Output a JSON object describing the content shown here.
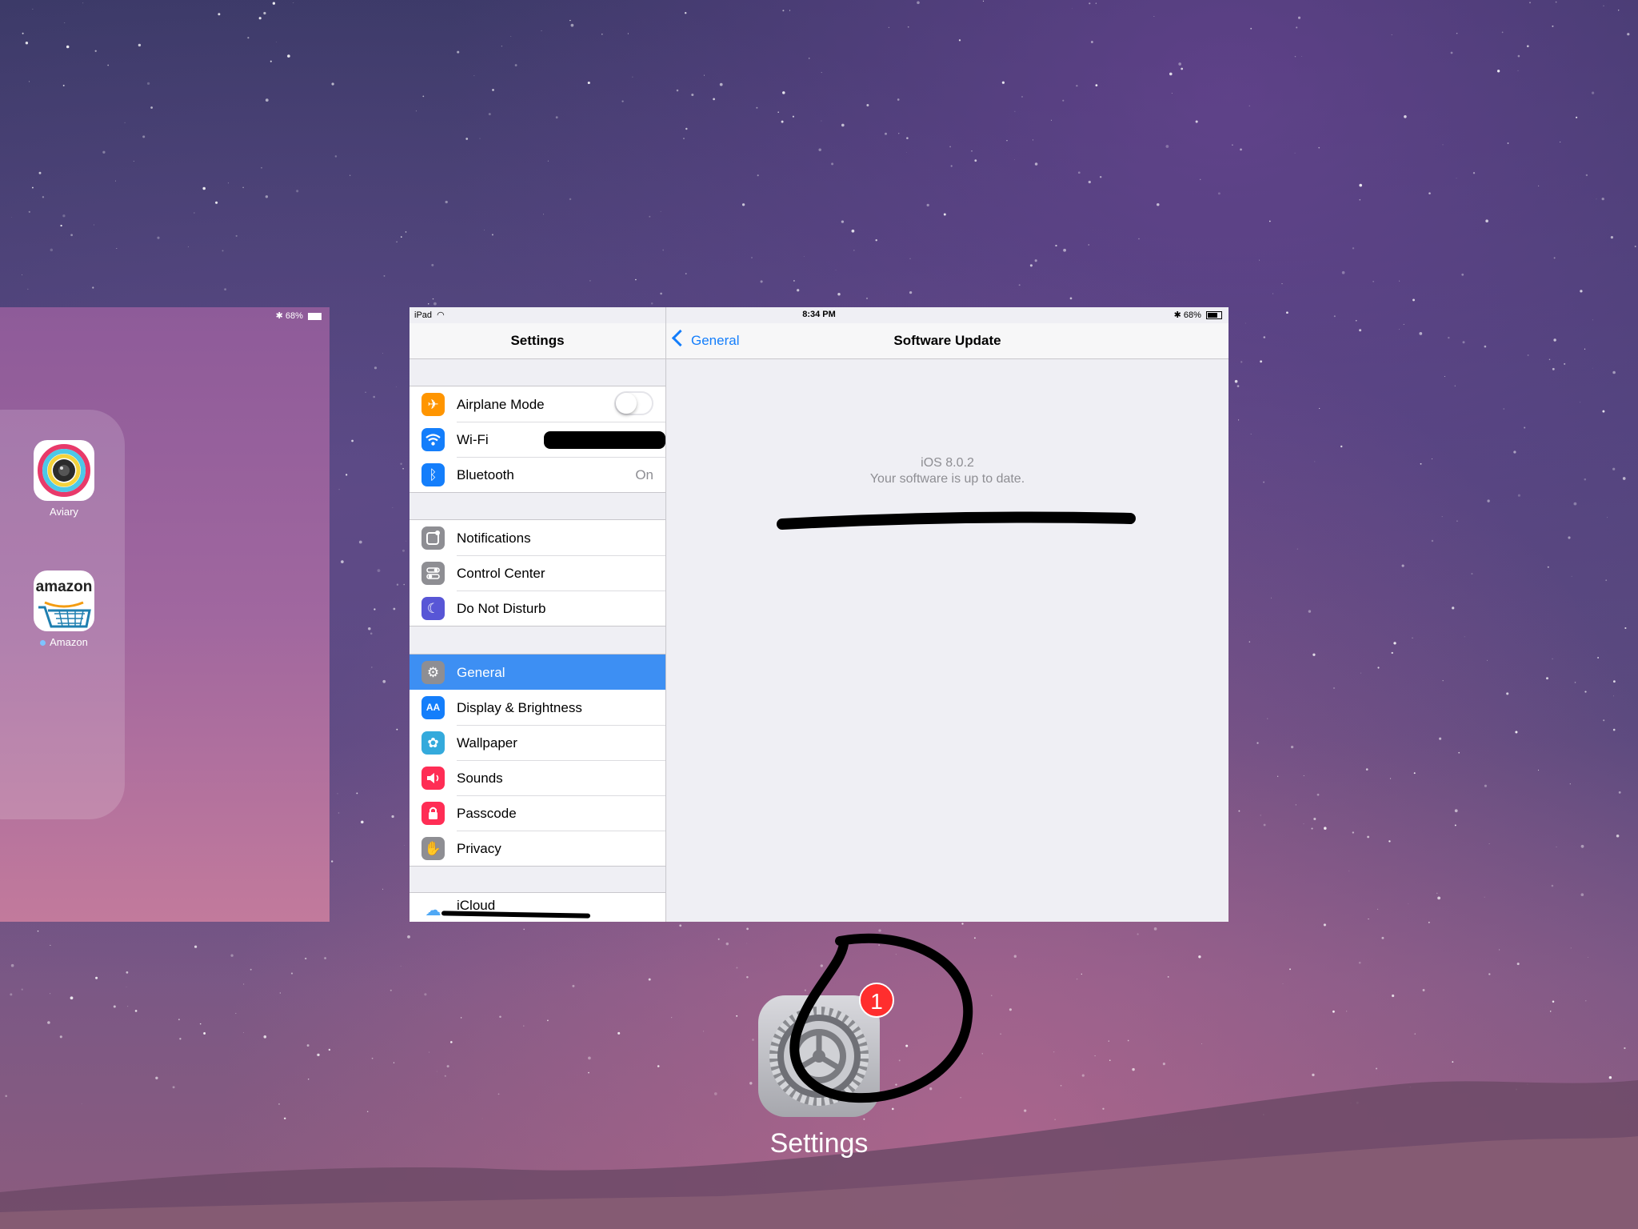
{
  "home_card": {
    "status_text": "68%",
    "apps": [
      {
        "label": "Aviary",
        "icon": "aviary-icon"
      },
      {
        "label": "Amazon",
        "icon": "amazon-icon",
        "icon_text": "amazon"
      }
    ]
  },
  "status_bar": {
    "device": "iPad",
    "time": "8:34 PM",
    "battery": "68%"
  },
  "master": {
    "title": "Settings",
    "groups": [
      {
        "rows": [
          {
            "label": "Airplane Mode",
            "icon": "airplane-icon",
            "color": "#ff9500",
            "toggle": "off"
          },
          {
            "label": "Wi-Fi",
            "icon": "wifi-icon",
            "color": "#147efb"
          },
          {
            "label": "Bluetooth",
            "icon": "bluetooth-icon",
            "color": "#147efb",
            "value": "On"
          }
        ]
      },
      {
        "rows": [
          {
            "label": "Notifications",
            "icon": "notifications-icon",
            "color": "#8e8e93"
          },
          {
            "label": "Control Center",
            "icon": "control-center-icon",
            "color": "#8e8e93"
          },
          {
            "label": "Do Not Disturb",
            "icon": "moon-icon",
            "color": "#5856d6"
          }
        ]
      },
      {
        "rows": [
          {
            "label": "General",
            "icon": "gear-icon",
            "color": "#8e8e93",
            "selected": true
          },
          {
            "label": "Display & Brightness",
            "icon": "display-brightness-icon",
            "color": "#147efb"
          },
          {
            "label": "Wallpaper",
            "icon": "wallpaper-icon",
            "color": "#34aadc"
          },
          {
            "label": "Sounds",
            "icon": "speaker-icon",
            "color": "#ff2d55"
          },
          {
            "label": "Passcode",
            "icon": "lock-icon",
            "color": "#ff2d55"
          },
          {
            "label": "Privacy",
            "icon": "hand-icon",
            "color": "#8e8e93"
          }
        ]
      },
      {
        "rows": [
          {
            "label": "iCloud",
            "icon": "icloud-icon",
            "color": "#ffffff"
          }
        ]
      }
    ]
  },
  "detail": {
    "back_label": "General",
    "title": "Software Update",
    "version": "iOS 8.0.2",
    "status": "Your software is up to date."
  },
  "dock": {
    "app_label": "Settings",
    "badge": "1"
  },
  "colors": {
    "accent": "#147efb",
    "selected_row": "#3d8ff3",
    "badge": "#ff2e2e"
  }
}
